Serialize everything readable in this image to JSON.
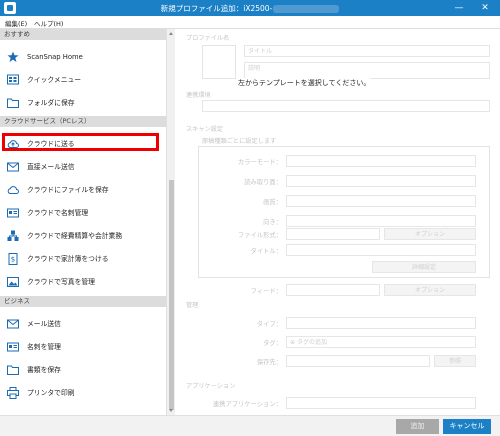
{
  "window": {
    "title": "新規プロファイル追加：iX2500-"
  },
  "menu": {
    "edit": "編集(E)",
    "help": "ヘルプ(H)"
  },
  "sidebar": {
    "sections": [
      {
        "label": "おすすめ"
      },
      {
        "label": "クラウドサービス（PCレス）"
      },
      {
        "label": "ビジネス"
      }
    ],
    "items": [
      {
        "label": "ScanSnap Home",
        "icon": "star-icon"
      },
      {
        "label": "クイックメニュー",
        "icon": "quick-menu-icon"
      },
      {
        "label": "フォルダに保存",
        "icon": "folder-icon"
      },
      {
        "label": "クラウドに送る",
        "icon": "cloud-upload-icon"
      },
      {
        "label": "直接メール送信",
        "icon": "mail-icon"
      },
      {
        "label": "クラウドにファイルを保存",
        "icon": "cloud-icon"
      },
      {
        "label": "クラウドで名刺管理",
        "icon": "business-card-icon"
      },
      {
        "label": "クラウドで経費精算や会計業務",
        "icon": "expense-icon"
      },
      {
        "label": "クラウドで家計簿をつける",
        "icon": "household-budget-icon"
      },
      {
        "label": "クラウドで写真を管理",
        "icon": "photo-icon"
      },
      {
        "label": "メール送信",
        "icon": "mail-icon"
      },
      {
        "label": "名刺を管理",
        "icon": "business-card-icon"
      },
      {
        "label": "書類を保存",
        "icon": "folder-icon"
      },
      {
        "label": "プリンタで印刷",
        "icon": "printer-icon"
      }
    ]
  },
  "main": {
    "profile_name_label": "プロファイル名",
    "title_placeholder": "タイトル",
    "description_placeholder": "説明",
    "message": "左からテンプレートを選択してください。",
    "usage_label": "連携環境",
    "scan_settings_label": "スキャン設定",
    "doc_type_label": "原稿種類ごとに設定します",
    "color_mode_label": "カラーモード：",
    "read_side_label": "読み取り面：",
    "image_quality_label": "画質：",
    "orientation_label": "向き：",
    "file_format_label": "ファイル形式：",
    "title_label": "タイトル：",
    "options_button": "オプション",
    "detail_button": "詳細設定",
    "feed_label": "フィード：",
    "feed_options_button": "オプション",
    "manage_section": "管理",
    "type_label": "タイプ：",
    "tag_label": "タグ：",
    "tag_add": "タグの追加",
    "save_to_label": "保存先：",
    "browse_button": "参照",
    "application_section": "アプリケーション",
    "app_label": "連携アプリケーション："
  },
  "footer": {
    "add_button": "追加",
    "cancel_button": "キャンセル"
  },
  "colors": {
    "accent": "#1b80c6",
    "highlight": "#e00000"
  }
}
